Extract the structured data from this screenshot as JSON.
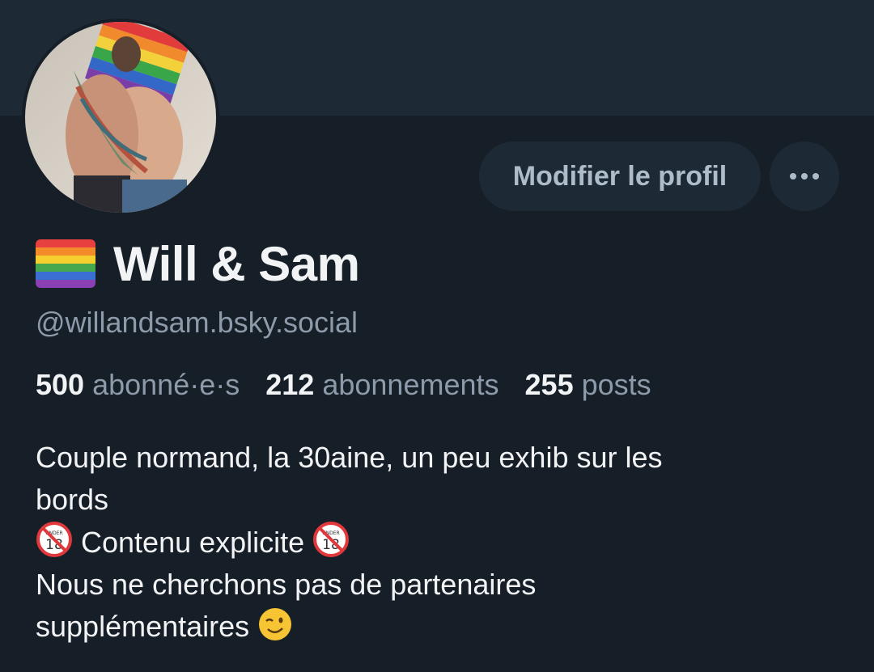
{
  "profile": {
    "display_name": "Will & Sam",
    "flag_icon": "rainbow-flag-icon",
    "handle": "@willandsam.bsky.social",
    "avatar_icon": "profile-avatar-photo"
  },
  "actions": {
    "edit_label": "Modifier le profil",
    "more_icon": "ellipsis-icon"
  },
  "stats": {
    "followers_count": "500",
    "followers_label": "abonné·e·s",
    "following_count": "212",
    "following_label": "abonnements",
    "posts_count": "255",
    "posts_label": "posts"
  },
  "bio": {
    "line1": "Couple normand, la 30aine, un peu exhib sur les",
    "line2": "bords",
    "line3": "Contenu explicite",
    "line4": "Nous ne cherchons pas de partenaires",
    "line5": "supplémentaires",
    "under18_icon": "no-under-18-icon",
    "wink_icon": "winking-face-icon"
  },
  "colors": {
    "background": "#161e27",
    "banner": "#1e2936",
    "button_bg": "#1e2936",
    "muted_text": "#8d9aa9",
    "primary_text": "#f1f3f5"
  }
}
